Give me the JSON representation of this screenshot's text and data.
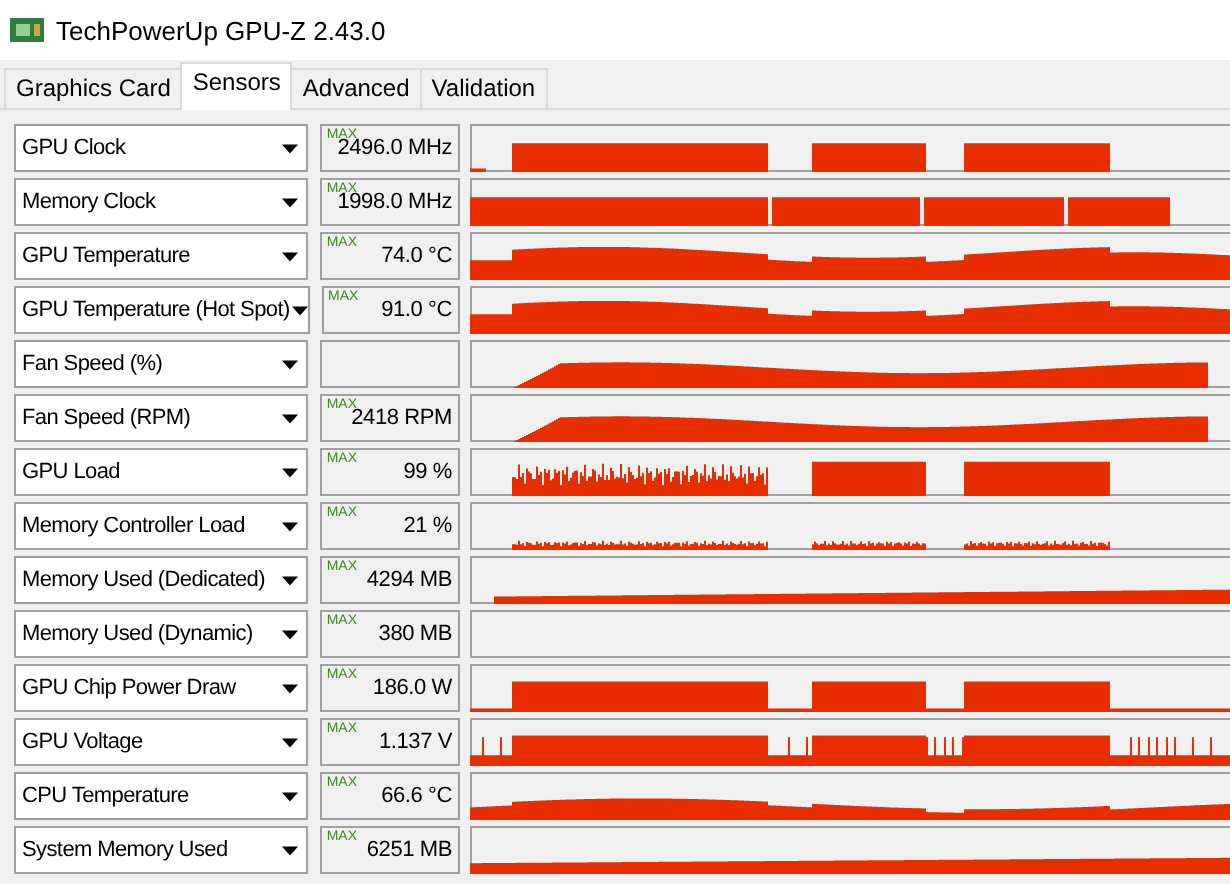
{
  "window": {
    "title": "TechPowerUp GPU-Z 2.43.0"
  },
  "tabs": [
    {
      "label": "Graphics Card",
      "selected": false
    },
    {
      "label": "Sensors",
      "selected": true
    },
    {
      "label": "Advanced",
      "selected": false
    },
    {
      "label": "Validation",
      "selected": false
    }
  ],
  "sensors": [
    {
      "name": "GPU Clock",
      "max_label": "MAX",
      "value": "2496.0 MHz"
    },
    {
      "name": "Memory Clock",
      "max_label": "MAX",
      "value": "1998.0 MHz"
    },
    {
      "name": "GPU Temperature",
      "max_label": "MAX",
      "value": "74.0 °C"
    },
    {
      "name": "GPU Temperature (Hot Spot)",
      "max_label": "MAX",
      "value": "91.0 °C"
    },
    {
      "name": "Fan Speed (%)"
    },
    {
      "name": "Fan Speed (RPM)",
      "max_label": "MAX",
      "value": "2418 RPM"
    },
    {
      "name": "GPU Load",
      "max_label": "MAX",
      "value": "99 %"
    },
    {
      "name": "Memory Controller Load",
      "max_label": "MAX",
      "value": "21 %"
    },
    {
      "name": "Memory Used (Dedicated)",
      "max_label": "MAX",
      "value": "4294 MB"
    },
    {
      "name": "Memory Used (Dynamic)",
      "max_label": "MAX",
      "value": "380 MB"
    },
    {
      "name": "GPU Chip Power Draw",
      "max_label": "MAX",
      "value": "186.0 W"
    },
    {
      "name": "GPU Voltage",
      "max_label": "MAX",
      "value": "1.137 V"
    },
    {
      "name": "CPU Temperature",
      "max_label": "MAX",
      "value": "66.6 °C"
    },
    {
      "name": "System Memory Used",
      "max_label": "MAX",
      "value": "6251 MB"
    }
  ]
}
